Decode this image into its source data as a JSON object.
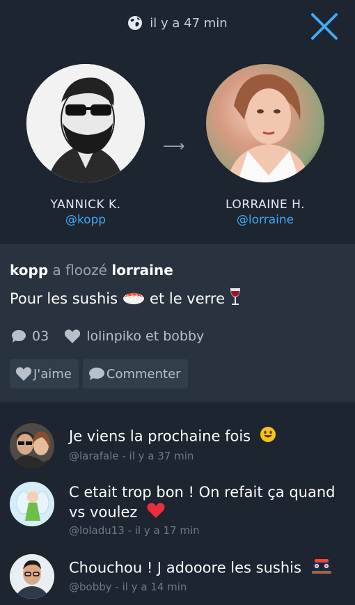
{
  "header": {
    "time_label": "il y a 47 min",
    "icons": {
      "globe": "globe-icon",
      "close": "close-icon"
    },
    "accent_color": "#3fa9f5"
  },
  "sender": {
    "name": "YANNICK K.",
    "handle": "@kopp"
  },
  "recipient": {
    "name": "LORRAINE H.",
    "handle": "@lorraine"
  },
  "transfer_arrow": "⟶",
  "post": {
    "from": "kopp",
    "verb": "a floozé",
    "to": "lorraine",
    "message_part1": "Pour les sushis",
    "message_part2": "et le verre",
    "comment_count": "03",
    "likers": "lolinpiko et bobby",
    "like_button": "J'aime",
    "comment_button": "Commenter"
  },
  "comments": [
    {
      "text": "Je viens la prochaine fois",
      "meta": "@larafale - il y a 37 min"
    },
    {
      "text": "C etait trop bon ! On refait ça quand vs voulez",
      "meta": "@loladu13 - il y a 17 min"
    },
    {
      "text": "Chouchou ! J adooore les sushis",
      "meta": "@bobby - il y a 14 min"
    }
  ]
}
